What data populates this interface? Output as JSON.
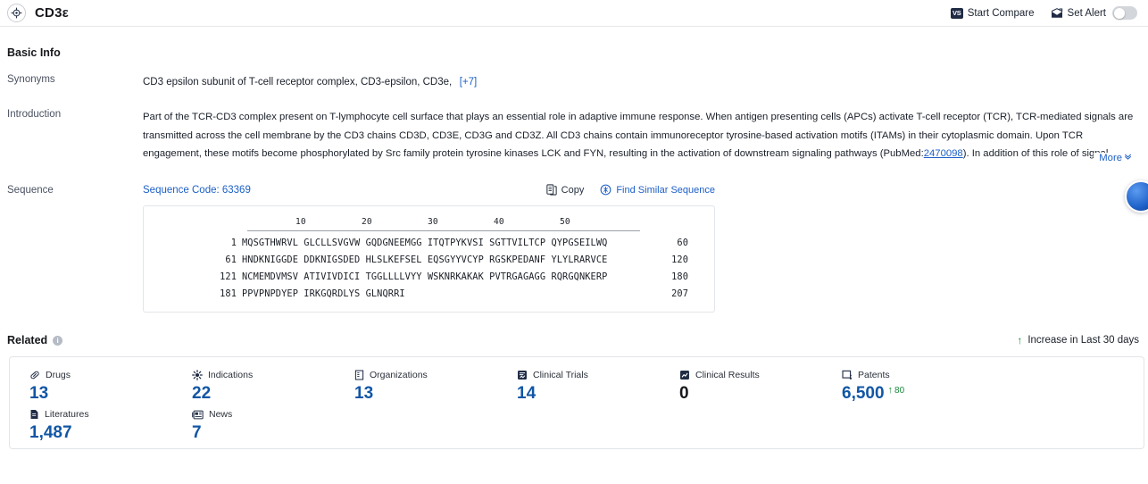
{
  "header": {
    "title": "CD3ε",
    "brand_icon": "target-icon",
    "compare_badge": "VS",
    "compare_label": "Start Compare",
    "alert_icon": "alert-mail-icon",
    "alert_label": "Set Alert",
    "alert_toggle_state": "off"
  },
  "basic_info": {
    "section_title": "Basic Info",
    "synonyms": {
      "label": "Synonyms",
      "value": "CD3 epsilon subunit of T-cell receptor complex,  CD3-epsilon,  CD3e,",
      "more_count": "[+7]"
    },
    "introduction": {
      "label": "Introduction",
      "part1": "Part of the TCR-CD3 complex present on T-lymphocyte cell surface that plays an essential role in adaptive immune response. When antigen presenting cells (APCs) activate T-cell receptor (TCR), TCR-mediated signals are transmitted across the cell membrane by the CD3 chains CD3D, CD3E, CD3G and CD3Z. All CD3 chains contain immunoreceptor tyrosine-based activation motifs (ITAMs) in their cytoplasmic domain. Upon TCR engagement, these motifs become phosphorylated by Src family protein tyrosine kinases LCK and FYN, resulting in the activation of downstream signaling pathways (PubMed:",
      "pubmed_id": "2470098",
      "part2": "). In addition of this role of signal transduction",
      "more_label": "More",
      "more_chevron": "»"
    }
  },
  "sequence": {
    "label": "Sequence",
    "code_label": "Sequence Code: 63369",
    "copy_label": "Copy",
    "copy_icon": "copy-icon",
    "find_label": "Find Similar Sequence",
    "find_icon": "find-similar-icon",
    "ruler": [
      "10",
      "20",
      "30",
      "40",
      "50"
    ],
    "rows": [
      {
        "start": "1",
        "chunks": "MQSGTHWRVL GLCLLSVGVW GQDGNEEMGG ITQTPYKVSI SGTTVILTCP QYPGSEILWQ",
        "end": "60"
      },
      {
        "start": "61",
        "chunks": "HNDKNIGGDE DDKNIGSDED HLSLKEFSEL EQSGYYVCYP RGSKPEDANF YLYLRARVCE",
        "end": "120"
      },
      {
        "start": "121",
        "chunks": "NCMEMDVMSV ATIVIVDICI TGGLLLLVYY WSKNRKAKAK PVTRGAGAGG RQRGQNKERP",
        "end": "180"
      },
      {
        "start": "181",
        "chunks": "PPVPNPDYEP IRKGQRDLYS GLNQRRI",
        "end": "207"
      }
    ]
  },
  "related": {
    "title": "Related",
    "info_icon": "info-icon",
    "legend_label": "Increase in Last 30 days",
    "legend_arrow": "↑",
    "stats": [
      {
        "icon": "drug-capsule-icon",
        "label": "Drugs",
        "value": "13",
        "is_zero": false,
        "delta": null
      },
      {
        "icon": "indications-icon",
        "label": "Indications",
        "value": "22",
        "is_zero": false,
        "delta": null
      },
      {
        "icon": "organizations-icon",
        "label": "Organizations",
        "value": "13",
        "is_zero": false,
        "delta": null
      },
      {
        "icon": "clinical-trials-icon",
        "label": "Clinical Trials",
        "value": "14",
        "is_zero": false,
        "delta": null
      },
      {
        "icon": "clinical-results-icon",
        "label": "Clinical Results",
        "value": "0",
        "is_zero": true,
        "delta": null
      },
      {
        "icon": "patents-icon",
        "label": "Patents",
        "value": "6,500",
        "is_zero": false,
        "delta": "80"
      },
      {
        "icon": "literatures-icon",
        "label": "Literatures",
        "value": "1,487",
        "is_zero": false,
        "delta": null
      },
      {
        "icon": "news-icon",
        "label": "News",
        "value": "7",
        "is_zero": false,
        "delta": null
      }
    ]
  },
  "colors": {
    "link_blue": "#1c5fc6",
    "value_blue": "#1156a5",
    "increase_green": "#1a8a3c",
    "border": "#e2e5e9"
  }
}
